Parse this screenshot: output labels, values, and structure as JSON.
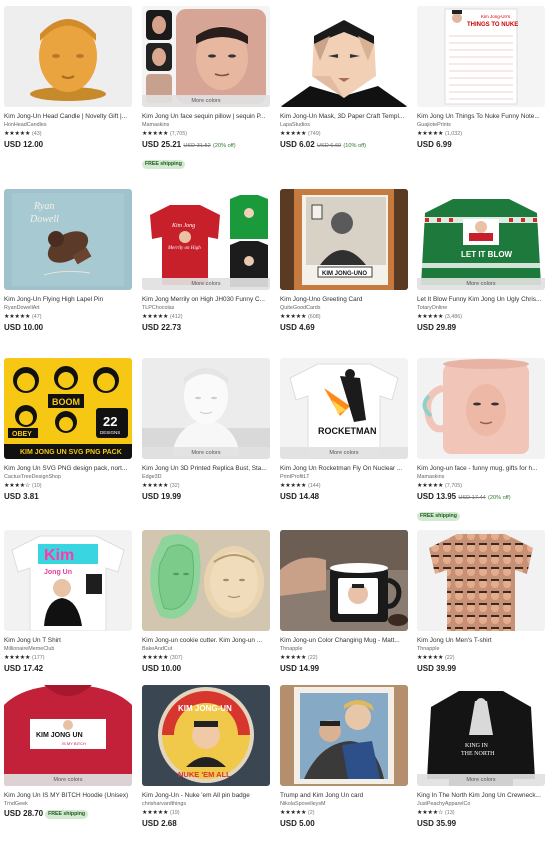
{
  "more_colors_label": "More colors",
  "free_shipping_label": "FREE shipping",
  "star_glyphs": "★★★★★",
  "star_glyphs_45": "★★★★☆",
  "listings": [
    {
      "title": "Kim Jong-Un Head Candle | Novelty Gift |...",
      "shop": "HonHeadCandles",
      "count": "(43)",
      "price": "USD 12.00",
      "orig": "",
      "disc": "",
      "ship": false,
      "more": false
    },
    {
      "title": "Kim Jong Un face sequin pillow | sequin P...",
      "shop": "Mamaskins",
      "count": "(7,705)",
      "price": "USD 25.21",
      "orig": "USD 31.52",
      "disc": "(20% off)",
      "ship": true,
      "more": true
    },
    {
      "title": "Kim Jong-Un Mask, 3D Paper Craft Templ...",
      "shop": "LapaStudios",
      "count": "(749)",
      "price": "USD 6.02",
      "orig": "USD 6.69",
      "disc": "(10% off)",
      "ship": false,
      "more": false
    },
    {
      "title": "Kim Jong Un Things To Nuke Funny Note...",
      "shop": "GuajiotePrints",
      "count": "(1,032)",
      "price": "USD 6.99",
      "orig": "",
      "disc": "",
      "ship": false,
      "more": false
    },
    {
      "title": "Kim Jong-Un Flying High Lapel Pin",
      "shop": "RyanDowellArt",
      "count": "(47)",
      "price": "USD 10.00",
      "orig": "",
      "disc": "",
      "ship": false,
      "more": false
    },
    {
      "title": "Kim Jong Merrily on High JH030 Funny C...",
      "shop": "TLPChocolas",
      "count": "(412)",
      "price": "USD 22.73",
      "orig": "",
      "disc": "",
      "ship": false,
      "more": true
    },
    {
      "title": "Kim Jong-Uno Greeting Card",
      "shop": "QuiteGoodCards",
      "count": "(608)",
      "price": "USD 4.69",
      "orig": "",
      "disc": "",
      "ship": false,
      "more": false
    },
    {
      "title": "Let It Blow Funny Kim Jong Un Ugly Chris...",
      "shop": "TotaryOnline",
      "count": "(3,486)",
      "price": "USD 29.89",
      "orig": "",
      "disc": "",
      "ship": false,
      "more": true
    },
    {
      "title": "Kim Jong Un SVG PNG design pack, nort...",
      "shop": "CactusTreeDesignShop",
      "count": "(10)",
      "price": "USD 3.81",
      "orig": "",
      "disc": "",
      "ship": false,
      "more": false
    },
    {
      "title": "Kim Jong Un 3D Printed Replica Bust, Sta...",
      "shop": "Edge3D",
      "count": "(32)",
      "price": "USD 19.99",
      "orig": "",
      "disc": "",
      "ship": false,
      "more": true
    },
    {
      "title": "Kim Jong Un Rocketman Fly On Nuclear ...",
      "shop": "PrintProfitLT",
      "count": "(144)",
      "price": "USD 14.48",
      "orig": "",
      "disc": "",
      "ship": false,
      "more": true
    },
    {
      "title": "Kim Jong-un face - funny mug, gifts for h...",
      "shop": "Mamaskins",
      "count": "(7,705)",
      "price": "USD 13.95",
      "orig": "USD 17.44",
      "disc": "(20% off)",
      "ship": true,
      "more": false
    },
    {
      "title": "Kim Jong Un T Shirt",
      "shop": "MillionaireMemeClub",
      "count": "(177)",
      "price": "USD 17.42",
      "orig": "",
      "disc": "",
      "ship": false,
      "more": false
    },
    {
      "title": "Kim Jong-un cookie cutter. Kim Jong-un ...",
      "shop": "BakeAndCut",
      "count": "(307)",
      "price": "USD 10.00",
      "orig": "",
      "disc": "",
      "ship": false,
      "more": false
    },
    {
      "title": "Kim Jong-un Color Changing Mug - Matt...",
      "shop": "Thnapple",
      "count": "(22)",
      "price": "USD 14.99",
      "orig": "",
      "disc": "",
      "ship": false,
      "more": false
    },
    {
      "title": "Kim Jong Un Men's T-shirt",
      "shop": "Thnapple",
      "count": "(22)",
      "price": "USD 39.99",
      "orig": "",
      "disc": "",
      "ship": false,
      "more": false
    },
    {
      "title": "Kim Jong Un IS MY BITCH Hoodie (Unisex)",
      "shop": "TrndGeek",
      "count": "",
      "price": "USD 28.70",
      "orig": "",
      "disc": "",
      "ship": true,
      "more": true
    },
    {
      "title": "Kim Jong-Un - Nuke 'em All pin badge",
      "shop": "chrisharvardthings",
      "count": "(19)",
      "price": "USD 2.68",
      "orig": "",
      "disc": "",
      "ship": false,
      "more": false
    },
    {
      "title": "Trump and Kim Jong Un card",
      "shop": "NikolaSpovelleysM",
      "count": "(2)",
      "price": "USD 5.00",
      "orig": "",
      "disc": "",
      "ship": false,
      "more": false
    },
    {
      "title": "King In The North Kim Jong Un Crewneck...",
      "shop": "JustPeachyApparelCo",
      "count": "(13)",
      "price": "USD 35.99",
      "orig": "",
      "disc": "",
      "ship": false,
      "more": true
    }
  ],
  "image_text": {
    "nuke_list_line1": "Kim Jong-Un's",
    "nuke_list_line2": "THINGS TO NUKE",
    "pin_name_line1": "Ryan",
    "pin_name_line2": "Dowell",
    "sweater_red_line1": "Kim Jong",
    "sweater_red_line2": "Merrily on High",
    "card_caption": "KIM JONG-UNO",
    "sweater_green_text": "LET IT BLOW",
    "svg_boom": "BOOM",
    "svg_obey": "OBEY",
    "svg_count": "22",
    "svg_designs": "DESIGNS",
    "svg_footer": "KIM JONG UN SVG PNG PACK",
    "rocketman": "ROCKETMAN",
    "tshirt_kim": "Kim",
    "tshirt_jong": "Jong Un",
    "hoodie_line1": "KIM JONG UN",
    "hoodie_line2": "IS MY BITCH",
    "badge_top": "KIM JONG-UN",
    "badge_bottom": "NUKE 'EM ALL",
    "king_line1": "KING IN",
    "king_line2": "THE NORTH"
  }
}
